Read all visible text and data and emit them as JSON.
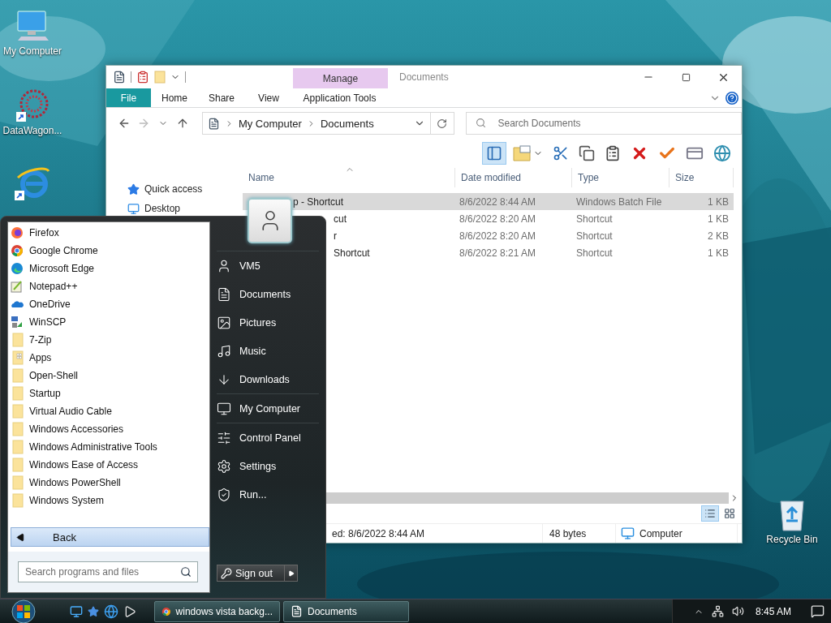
{
  "desktop": {
    "icons": [
      {
        "label": "My Computer",
        "kind": "computer"
      },
      {
        "label": "DataWagon...",
        "kind": "emblem"
      },
      {
        "kind": "browser"
      },
      {
        "label": "Recycle Bin",
        "kind": "recycle"
      }
    ]
  },
  "explorer": {
    "title": "Documents",
    "contextual_group": "Manage",
    "file_tab": "File",
    "tabs": [
      "Home",
      "Share",
      "View"
    ],
    "contextual_tab": "Application Tools",
    "address": [
      "My Computer",
      "Documents"
    ],
    "search": {
      "placeholder": "Search Documents"
    },
    "toolbar": [
      {
        "kind": "pane",
        "selected": true
      },
      {
        "kind": "properties",
        "selected": false
      },
      {
        "kind": "cut",
        "selected": false
      },
      {
        "kind": "copy",
        "selected": false
      },
      {
        "kind": "paste",
        "selected": false
      },
      {
        "kind": "delete",
        "selected": false
      },
      {
        "kind": "check",
        "selected": false
      },
      {
        "kind": "rename",
        "selected": false
      },
      {
        "kind": "globe",
        "selected": false
      }
    ],
    "nav": [
      {
        "label": "Quick access",
        "kind": "star"
      },
      {
        "label": "Desktop",
        "kind": "desktop"
      }
    ],
    "columns": [
      "Name",
      "Date modified",
      "Type",
      "Size"
    ],
    "rows": [
      {
        "name": "p - Shortcut",
        "date": "8/6/2022 8:44 AM",
        "type": "Windows Batch File",
        "size": "1 KB",
        "selected": true
      },
      {
        "name": "cut",
        "date": "8/6/2022 8:20 AM",
        "type": "Shortcut",
        "size": "1 KB",
        "selected": false
      },
      {
        "name": "r",
        "date": "8/6/2022 8:20 AM",
        "type": "Shortcut",
        "size": "2 KB",
        "selected": false
      },
      {
        "name": "Shortcut",
        "date": "8/6/2022 8:21 AM",
        "type": "Shortcut",
        "size": "1 KB",
        "selected": false
      }
    ],
    "view_buttons": [
      {
        "kind": "details",
        "selected": true
      },
      {
        "kind": "tiles",
        "selected": false
      }
    ],
    "status": {
      "modified": "ed: 8/6/2022 8:44 AM",
      "size": "48 bytes",
      "location": "Computer"
    }
  },
  "start_menu": {
    "programs": [
      {
        "label": "Firefox",
        "kind": "fox"
      },
      {
        "label": "Google Chrome",
        "kind": "ring"
      },
      {
        "label": "Microsoft Edge",
        "kind": "wave"
      },
      {
        "label": "Notepad++",
        "kind": "notepad"
      },
      {
        "label": "OneDrive",
        "kind": "cloud"
      },
      {
        "label": "WinSCP",
        "kind": "lock"
      },
      {
        "label": "7-Zip",
        "kind": "folder"
      },
      {
        "label": "Apps",
        "kind": "apps"
      },
      {
        "label": "Open-Shell",
        "kind": "folder"
      },
      {
        "label": "Startup",
        "kind": "folder"
      },
      {
        "label": "Virtual Audio Cable",
        "kind": "folder"
      },
      {
        "label": "Windows Accessories",
        "kind": "folder"
      },
      {
        "label": "Windows Administrative Tools",
        "kind": "folder"
      },
      {
        "label": "Windows Ease of Access",
        "kind": "folder"
      },
      {
        "label": "Windows PowerShell",
        "kind": "folder"
      },
      {
        "label": "Windows System",
        "kind": "folder"
      }
    ],
    "back": "Back",
    "search": {
      "placeholder": "Search programs and files"
    },
    "place_groups": [
      [
        {
          "label": "VM5",
          "kind": "user"
        },
        {
          "label": "Documents",
          "kind": "document"
        },
        {
          "label": "Pictures",
          "kind": "pictures"
        },
        {
          "label": "Music",
          "kind": "music"
        },
        {
          "label": "Downloads",
          "kind": "downloads"
        }
      ],
      [
        {
          "label": "My Computer",
          "kind": "computer"
        }
      ],
      [
        {
          "label": "Control Panel",
          "kind": "panel"
        },
        {
          "label": "Settings",
          "kind": "settings"
        },
        {
          "label": "Run...",
          "kind": "run"
        }
      ]
    ],
    "sign_out": "Sign out"
  },
  "taskbar": {
    "quick_launch": [
      {
        "kind": "desktop"
      },
      {
        "kind": "star"
      },
      {
        "kind": "browser"
      },
      {
        "kind": "media"
      }
    ],
    "tasks": [
      {
        "label": "windows vista backg...",
        "kind": "browser"
      },
      {
        "label": "Documents",
        "kind": "document"
      }
    ],
    "clock": "8:45 AM"
  }
}
